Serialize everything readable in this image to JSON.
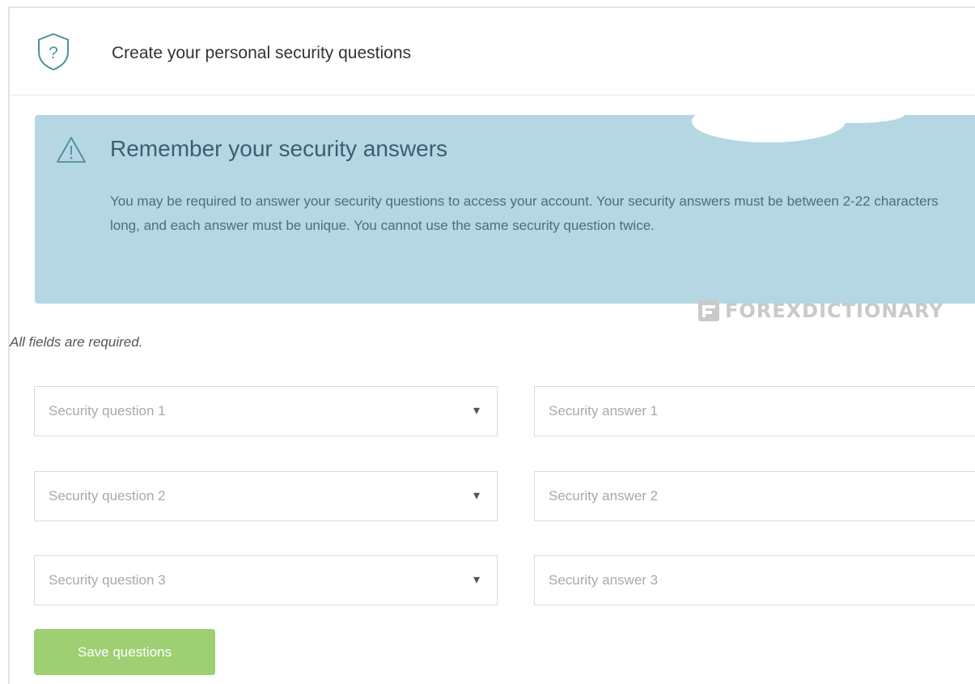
{
  "header": {
    "title": "Create your personal security questions",
    "icon": "shield-question-icon"
  },
  "alert": {
    "icon": "warning-triangle-icon",
    "title": "Remember your security answers",
    "body": "You may be required to answer your security questions to access your account. Your security answers must be between 2-22 characters long, and each answer must be unique. You cannot use the same security question twice.",
    "background_color": "#b4d7e3"
  },
  "watermark": {
    "text": "FOREXDICTIONARY"
  },
  "form": {
    "required_note": "All fields are required.",
    "rows": [
      {
        "question_placeholder": "Security question 1",
        "answer_placeholder": "Security answer 1"
      },
      {
        "question_placeholder": "Security question 2",
        "answer_placeholder": "Security answer 2"
      },
      {
        "question_placeholder": "Security question 3",
        "answer_placeholder": "Security answer 3"
      }
    ],
    "dropdown_caret": "▾",
    "save_label": "Save questions",
    "save_color": "#9ecf73"
  }
}
